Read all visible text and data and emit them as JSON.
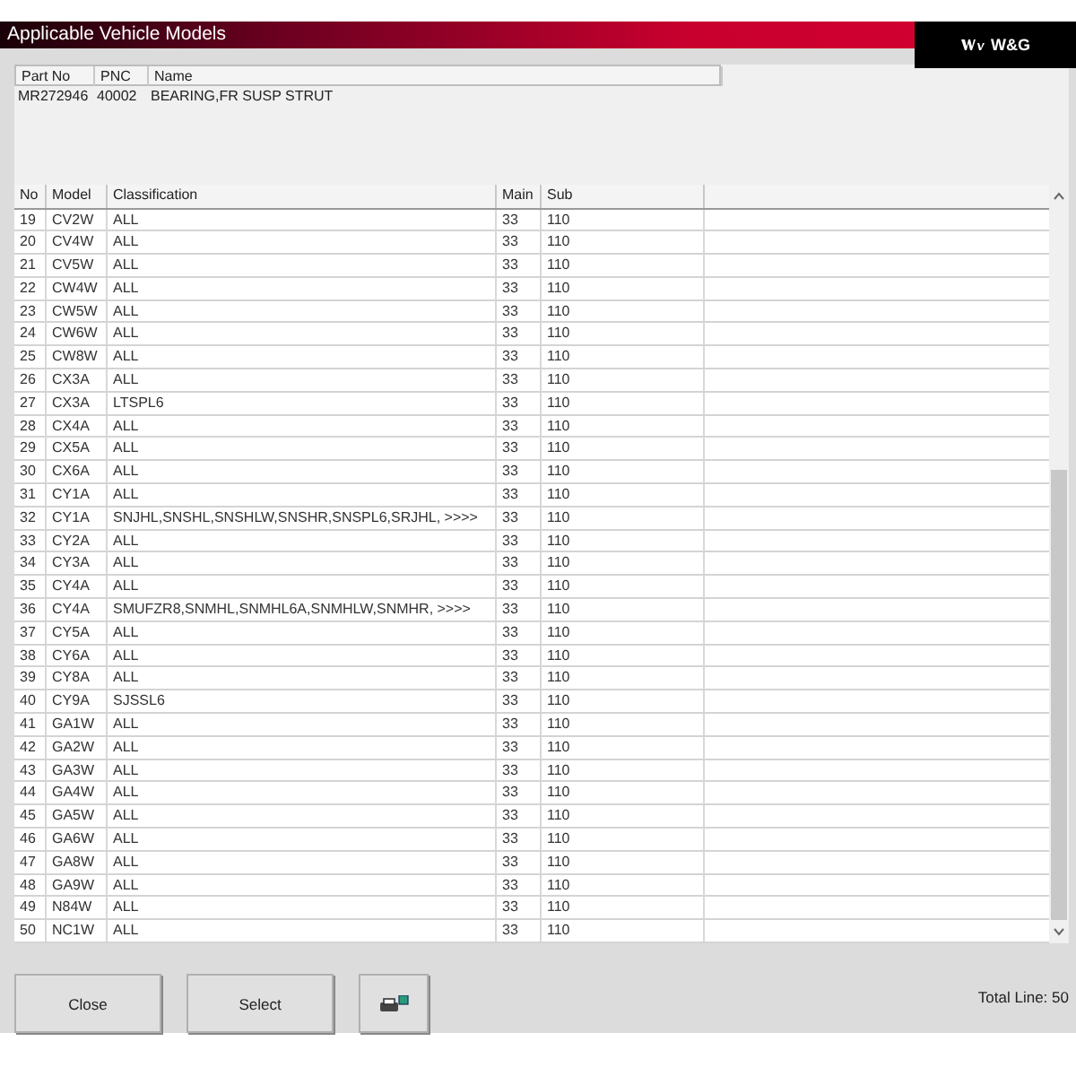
{
  "window": {
    "title": "Applicable Vehicle Models",
    "logo": "W&G"
  },
  "part_table": {
    "columns": [
      "Part No",
      "PNC",
      "Name"
    ],
    "rows": [
      [
        "MR272946",
        "40002",
        "BEARING,FR SUSP STRUT"
      ]
    ]
  },
  "model_table": {
    "columns": [
      "No",
      "Model",
      "Classification",
      "Main",
      "Sub"
    ],
    "rows": [
      [
        "19",
        "CV2W",
        "ALL",
        "33",
        "110"
      ],
      [
        "20",
        "CV4W",
        "ALL",
        "33",
        "110"
      ],
      [
        "21",
        "CV5W",
        "ALL",
        "33",
        "110"
      ],
      [
        "22",
        "CW4W",
        "ALL",
        "33",
        "110"
      ],
      [
        "23",
        "CW5W",
        "ALL",
        "33",
        "110"
      ],
      [
        "24",
        "CW6W",
        "ALL",
        "33",
        "110"
      ],
      [
        "25",
        "CW8W",
        "ALL",
        "33",
        "110"
      ],
      [
        "26",
        "CX3A",
        "ALL",
        "33",
        "110"
      ],
      [
        "27",
        "CX3A",
        "LTSPL6",
        "33",
        "110"
      ],
      [
        "28",
        "CX4A",
        "ALL",
        "33",
        "110"
      ],
      [
        "29",
        "CX5A",
        "ALL",
        "33",
        "110"
      ],
      [
        "30",
        "CX6A",
        "ALL",
        "33",
        "110"
      ],
      [
        "31",
        "CY1A",
        "ALL",
        "33",
        "110"
      ],
      [
        "32",
        "CY1A",
        "SNJHL,SNSHL,SNSHLW,SNSHR,SNSPL6,SRJHL,  >>>>",
        "33",
        "110"
      ],
      [
        "33",
        "CY2A",
        "ALL",
        "33",
        "110"
      ],
      [
        "34",
        "CY3A",
        "ALL",
        "33",
        "110"
      ],
      [
        "35",
        "CY4A",
        "ALL",
        "33",
        "110"
      ],
      [
        "36",
        "CY4A",
        "SMUFZR8,SNMHL,SNMHL6A,SNMHLW,SNMHR,  >>>>",
        "33",
        "110"
      ],
      [
        "37",
        "CY5A",
        "ALL",
        "33",
        "110"
      ],
      [
        "38",
        "CY6A",
        "ALL",
        "33",
        "110"
      ],
      [
        "39",
        "CY8A",
        "ALL",
        "33",
        "110"
      ],
      [
        "40",
        "CY9A",
        "SJSSL6",
        "33",
        "110"
      ],
      [
        "41",
        "GA1W",
        "ALL",
        "33",
        "110"
      ],
      [
        "42",
        "GA2W",
        "ALL",
        "33",
        "110"
      ],
      [
        "43",
        "GA3W",
        "ALL",
        "33",
        "110"
      ],
      [
        "44",
        "GA4W",
        "ALL",
        "33",
        "110"
      ],
      [
        "45",
        "GA5W",
        "ALL",
        "33",
        "110"
      ],
      [
        "46",
        "GA6W",
        "ALL",
        "33",
        "110"
      ],
      [
        "47",
        "GA8W",
        "ALL",
        "33",
        "110"
      ],
      [
        "48",
        "GA9W",
        "ALL",
        "33",
        "110"
      ],
      [
        "49",
        "N84W",
        "ALL",
        "33",
        "110"
      ],
      [
        "50",
        "NC1W",
        "ALL",
        "33",
        "110"
      ]
    ]
  },
  "buttons": [
    {
      "kind": "text",
      "label": "Close"
    },
    {
      "kind": "text",
      "label": "Select"
    },
    {
      "kind": "print"
    }
  ],
  "total_line": "Total Line: 50"
}
